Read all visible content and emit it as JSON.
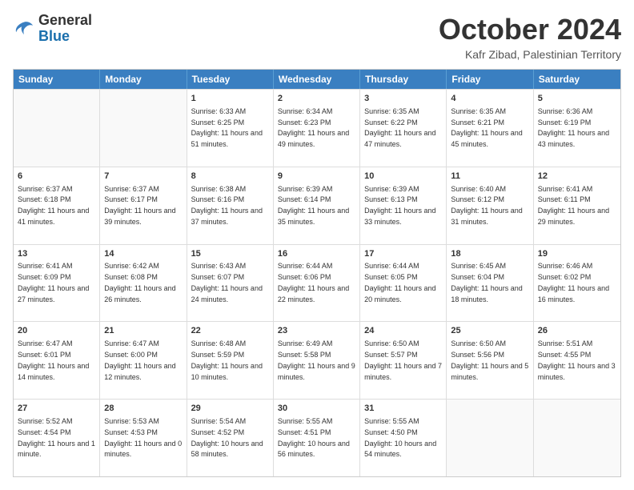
{
  "logo": {
    "general": "General",
    "blue": "Blue"
  },
  "header": {
    "month": "October 2024",
    "location": "Kafr Zibad, Palestinian Territory"
  },
  "days": [
    "Sunday",
    "Monday",
    "Tuesday",
    "Wednesday",
    "Thursday",
    "Friday",
    "Saturday"
  ],
  "rows": [
    [
      {
        "day": "",
        "content": ""
      },
      {
        "day": "",
        "content": ""
      },
      {
        "day": "1",
        "content": "Sunrise: 6:33 AM\nSunset: 6:25 PM\nDaylight: 11 hours and 51 minutes."
      },
      {
        "day": "2",
        "content": "Sunrise: 6:34 AM\nSunset: 6:23 PM\nDaylight: 11 hours and 49 minutes."
      },
      {
        "day": "3",
        "content": "Sunrise: 6:35 AM\nSunset: 6:22 PM\nDaylight: 11 hours and 47 minutes."
      },
      {
        "day": "4",
        "content": "Sunrise: 6:35 AM\nSunset: 6:21 PM\nDaylight: 11 hours and 45 minutes."
      },
      {
        "day": "5",
        "content": "Sunrise: 6:36 AM\nSunset: 6:19 PM\nDaylight: 11 hours and 43 minutes."
      }
    ],
    [
      {
        "day": "6",
        "content": "Sunrise: 6:37 AM\nSunset: 6:18 PM\nDaylight: 11 hours and 41 minutes."
      },
      {
        "day": "7",
        "content": "Sunrise: 6:37 AM\nSunset: 6:17 PM\nDaylight: 11 hours and 39 minutes."
      },
      {
        "day": "8",
        "content": "Sunrise: 6:38 AM\nSunset: 6:16 PM\nDaylight: 11 hours and 37 minutes."
      },
      {
        "day": "9",
        "content": "Sunrise: 6:39 AM\nSunset: 6:14 PM\nDaylight: 11 hours and 35 minutes."
      },
      {
        "day": "10",
        "content": "Sunrise: 6:39 AM\nSunset: 6:13 PM\nDaylight: 11 hours and 33 minutes."
      },
      {
        "day": "11",
        "content": "Sunrise: 6:40 AM\nSunset: 6:12 PM\nDaylight: 11 hours and 31 minutes."
      },
      {
        "day": "12",
        "content": "Sunrise: 6:41 AM\nSunset: 6:11 PM\nDaylight: 11 hours and 29 minutes."
      }
    ],
    [
      {
        "day": "13",
        "content": "Sunrise: 6:41 AM\nSunset: 6:09 PM\nDaylight: 11 hours and 27 minutes."
      },
      {
        "day": "14",
        "content": "Sunrise: 6:42 AM\nSunset: 6:08 PM\nDaylight: 11 hours and 26 minutes."
      },
      {
        "day": "15",
        "content": "Sunrise: 6:43 AM\nSunset: 6:07 PM\nDaylight: 11 hours and 24 minutes."
      },
      {
        "day": "16",
        "content": "Sunrise: 6:44 AM\nSunset: 6:06 PM\nDaylight: 11 hours and 22 minutes."
      },
      {
        "day": "17",
        "content": "Sunrise: 6:44 AM\nSunset: 6:05 PM\nDaylight: 11 hours and 20 minutes."
      },
      {
        "day": "18",
        "content": "Sunrise: 6:45 AM\nSunset: 6:04 PM\nDaylight: 11 hours and 18 minutes."
      },
      {
        "day": "19",
        "content": "Sunrise: 6:46 AM\nSunset: 6:02 PM\nDaylight: 11 hours and 16 minutes."
      }
    ],
    [
      {
        "day": "20",
        "content": "Sunrise: 6:47 AM\nSunset: 6:01 PM\nDaylight: 11 hours and 14 minutes."
      },
      {
        "day": "21",
        "content": "Sunrise: 6:47 AM\nSunset: 6:00 PM\nDaylight: 11 hours and 12 minutes."
      },
      {
        "day": "22",
        "content": "Sunrise: 6:48 AM\nSunset: 5:59 PM\nDaylight: 11 hours and 10 minutes."
      },
      {
        "day": "23",
        "content": "Sunrise: 6:49 AM\nSunset: 5:58 PM\nDaylight: 11 hours and 9 minutes."
      },
      {
        "day": "24",
        "content": "Sunrise: 6:50 AM\nSunset: 5:57 PM\nDaylight: 11 hours and 7 minutes."
      },
      {
        "day": "25",
        "content": "Sunrise: 6:50 AM\nSunset: 5:56 PM\nDaylight: 11 hours and 5 minutes."
      },
      {
        "day": "26",
        "content": "Sunrise: 5:51 AM\nSunset: 4:55 PM\nDaylight: 11 hours and 3 minutes."
      }
    ],
    [
      {
        "day": "27",
        "content": "Sunrise: 5:52 AM\nSunset: 4:54 PM\nDaylight: 11 hours and 1 minute."
      },
      {
        "day": "28",
        "content": "Sunrise: 5:53 AM\nSunset: 4:53 PM\nDaylight: 11 hours and 0 minutes."
      },
      {
        "day": "29",
        "content": "Sunrise: 5:54 AM\nSunset: 4:52 PM\nDaylight: 10 hours and 58 minutes."
      },
      {
        "day": "30",
        "content": "Sunrise: 5:55 AM\nSunset: 4:51 PM\nDaylight: 10 hours and 56 minutes."
      },
      {
        "day": "31",
        "content": "Sunrise: 5:55 AM\nSunset: 4:50 PM\nDaylight: 10 hours and 54 minutes."
      },
      {
        "day": "",
        "content": ""
      },
      {
        "day": "",
        "content": ""
      }
    ]
  ]
}
